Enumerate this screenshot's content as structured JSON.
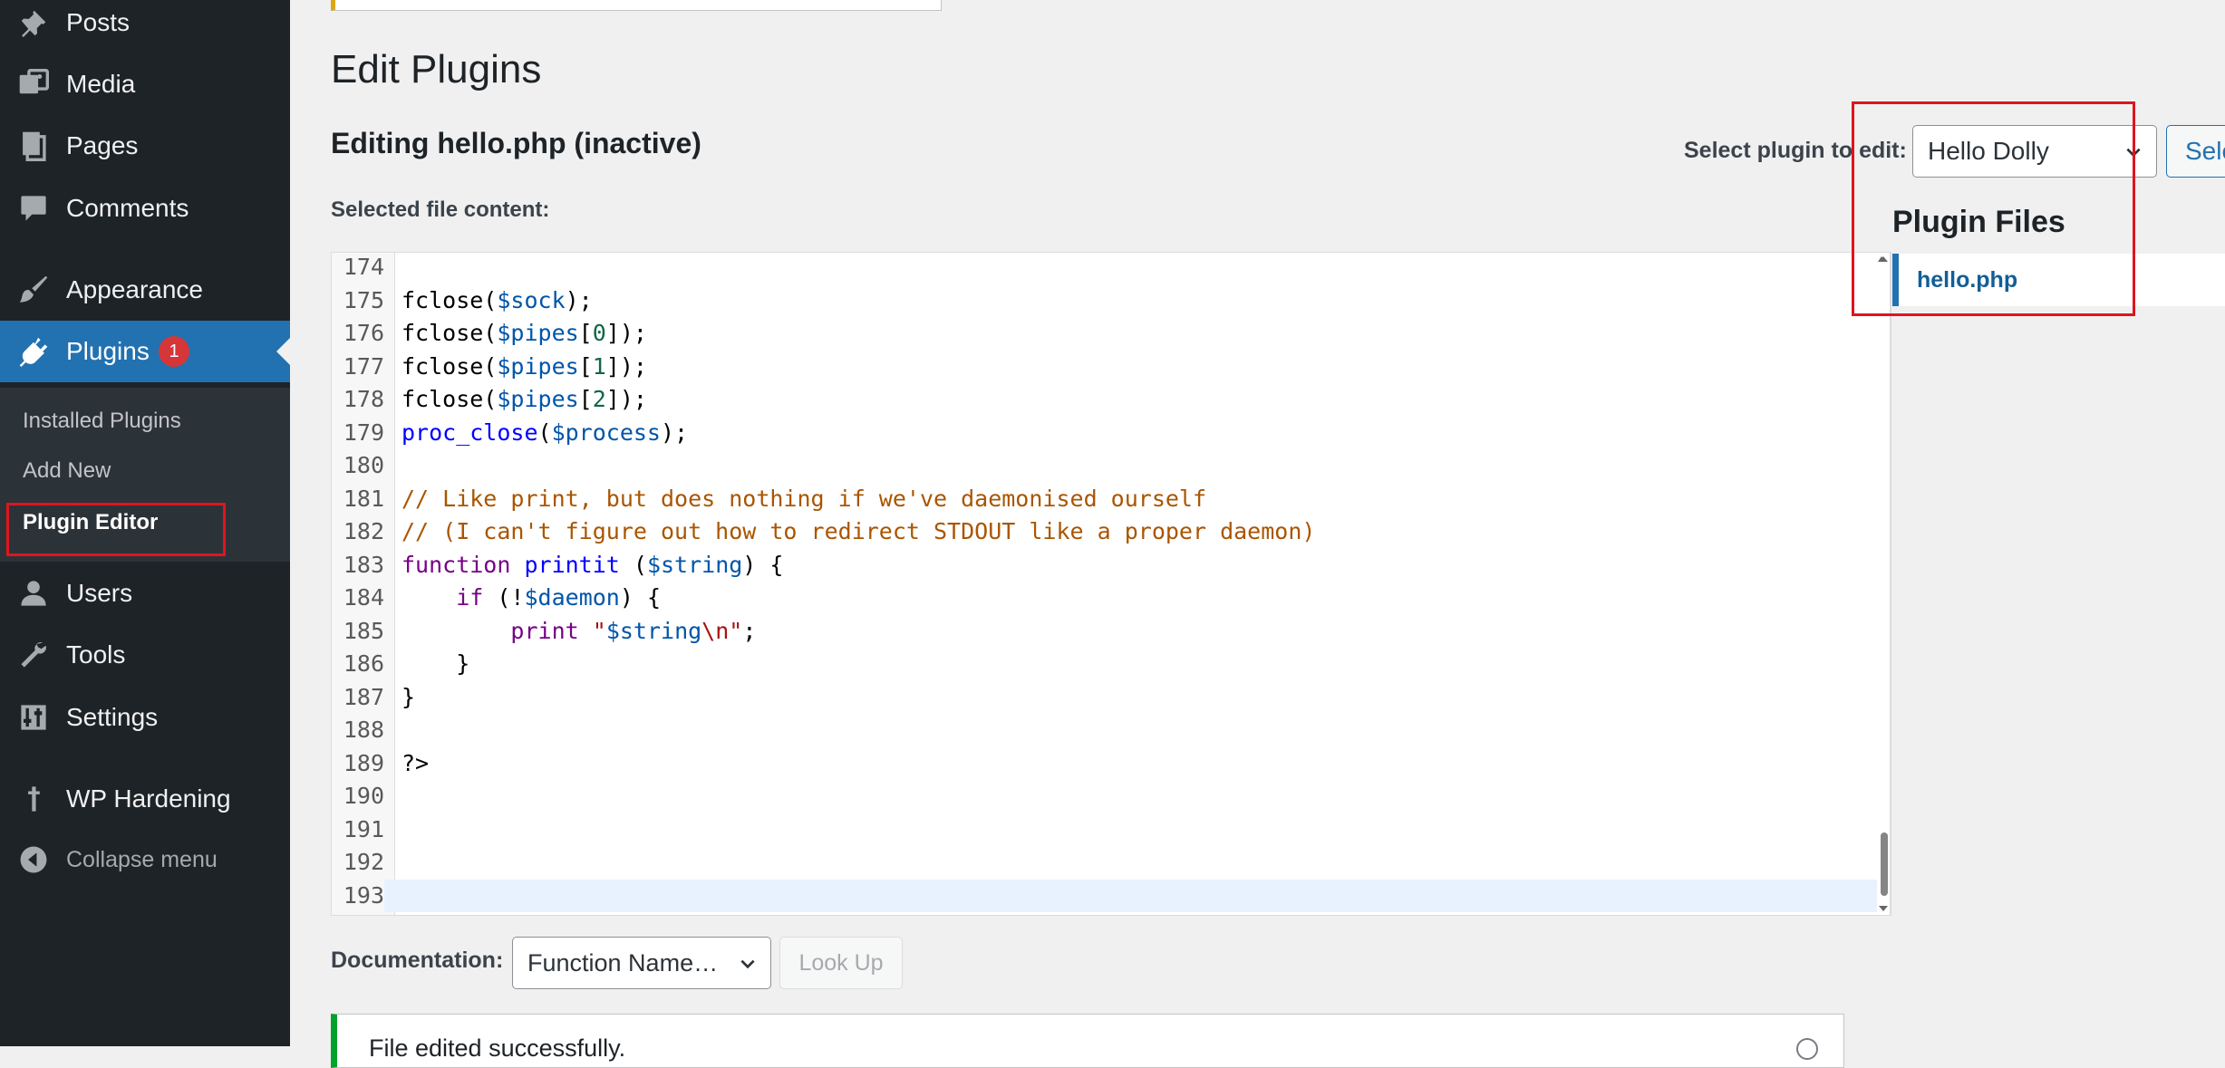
{
  "sidebar": {
    "items": [
      {
        "label": "Posts",
        "icon": "pushpin-icon"
      },
      {
        "label": "Media",
        "icon": "media-icon"
      },
      {
        "label": "Pages",
        "icon": "pages-icon"
      },
      {
        "label": "Comments",
        "icon": "comment-icon"
      },
      {
        "label": "Appearance",
        "icon": "paintbrush-icon"
      },
      {
        "label": "Plugins",
        "icon": "plugin-icon",
        "badge": "1"
      },
      {
        "label": "Users",
        "icon": "user-icon"
      },
      {
        "label": "Tools",
        "icon": "wrench-icon"
      },
      {
        "label": "Settings",
        "icon": "settings-icon"
      },
      {
        "label": "WP Hardening",
        "icon": "pin-icon"
      },
      {
        "label": "Collapse menu",
        "icon": "collapse-icon"
      }
    ],
    "submenu": [
      "Installed Plugins",
      "Add New",
      "Plugin Editor"
    ]
  },
  "main": {
    "title": "Edit Plugins",
    "editing": "Editing hello.php (inactive)",
    "selected_label": "Selected file content:",
    "select_label": "Select plugin to edit:",
    "select_value": "Hello Dolly",
    "select_button": "Select",
    "files_heading": "Plugin Files",
    "files": [
      "hello.php"
    ],
    "doc_label": "Documentation:",
    "doc_select": "Function Name…",
    "lookup": "Look Up",
    "notice": "File edited successfully."
  },
  "code": {
    "lines": [
      {
        "n": "174",
        "t": []
      },
      {
        "n": "175",
        "t": [
          [
            "fn",
            "fclose("
          ],
          [
            "var",
            "$sock"
          ],
          [
            "fn",
            ");"
          ]
        ]
      },
      {
        "n": "176",
        "t": [
          [
            "fn",
            "fclose("
          ],
          [
            "var",
            "$pipes"
          ],
          [
            "fn",
            "["
          ],
          [
            "num",
            "0"
          ],
          [
            "fn",
            "]);"
          ]
        ]
      },
      {
        "n": "177",
        "t": [
          [
            "fn",
            "fclose("
          ],
          [
            "var",
            "$pipes"
          ],
          [
            "fn",
            "["
          ],
          [
            "num",
            "1"
          ],
          [
            "fn",
            "]);"
          ]
        ]
      },
      {
        "n": "178",
        "t": [
          [
            "fn",
            "fclose("
          ],
          [
            "var",
            "$pipes"
          ],
          [
            "fn",
            "["
          ],
          [
            "num",
            "2"
          ],
          [
            "fn",
            "]);"
          ]
        ]
      },
      {
        "n": "179",
        "t": [
          [
            "def",
            "proc_close"
          ],
          [
            "fn",
            "("
          ],
          [
            "var",
            "$process"
          ],
          [
            "fn",
            ");"
          ]
        ]
      },
      {
        "n": "180",
        "t": []
      },
      {
        "n": "181",
        "t": [
          [
            "com",
            "// Like print, but does nothing if we've daemonised ourself"
          ]
        ]
      },
      {
        "n": "182",
        "t": [
          [
            "com",
            "// (I can't figure out how to redirect STDOUT like a proper daemon)"
          ]
        ]
      },
      {
        "n": "183",
        "t": [
          [
            "kw",
            "function "
          ],
          [
            "def",
            "printit"
          ],
          [
            "fn",
            " ("
          ],
          [
            "var",
            "$string"
          ],
          [
            "fn",
            ") {"
          ]
        ]
      },
      {
        "n": "184",
        "t": [
          [
            "fn",
            "    "
          ],
          [
            "kw",
            "if"
          ],
          [
            "fn",
            " (!"
          ],
          [
            "var",
            "$daemon"
          ],
          [
            "fn",
            ") {"
          ]
        ]
      },
      {
        "n": "185",
        "t": [
          [
            "fn",
            "        "
          ],
          [
            "kw",
            "print"
          ],
          [
            "fn",
            " "
          ],
          [
            "str",
            "\""
          ],
          [
            "var",
            "$string"
          ],
          [
            "esc",
            "\\n"
          ],
          [
            "str",
            "\""
          ],
          [
            "fn",
            ";"
          ]
        ]
      },
      {
        "n": "186",
        "t": [
          [
            "fn",
            "    }"
          ]
        ]
      },
      {
        "n": "187",
        "t": [
          [
            "fn",
            "}"
          ]
        ]
      },
      {
        "n": "188",
        "t": []
      },
      {
        "n": "189",
        "t": [
          [
            "fn",
            "?>"
          ]
        ]
      },
      {
        "n": "190",
        "t": []
      },
      {
        "n": "191",
        "t": []
      },
      {
        "n": "192",
        "t": []
      },
      {
        "n": "193",
        "t": [],
        "active": true
      }
    ]
  },
  "colors": {
    "sidebar_bg": "#1d2327",
    "accent": "#2271b1",
    "badge": "#d63638",
    "success": "#00a32a",
    "annotation": "#e0141e"
  }
}
